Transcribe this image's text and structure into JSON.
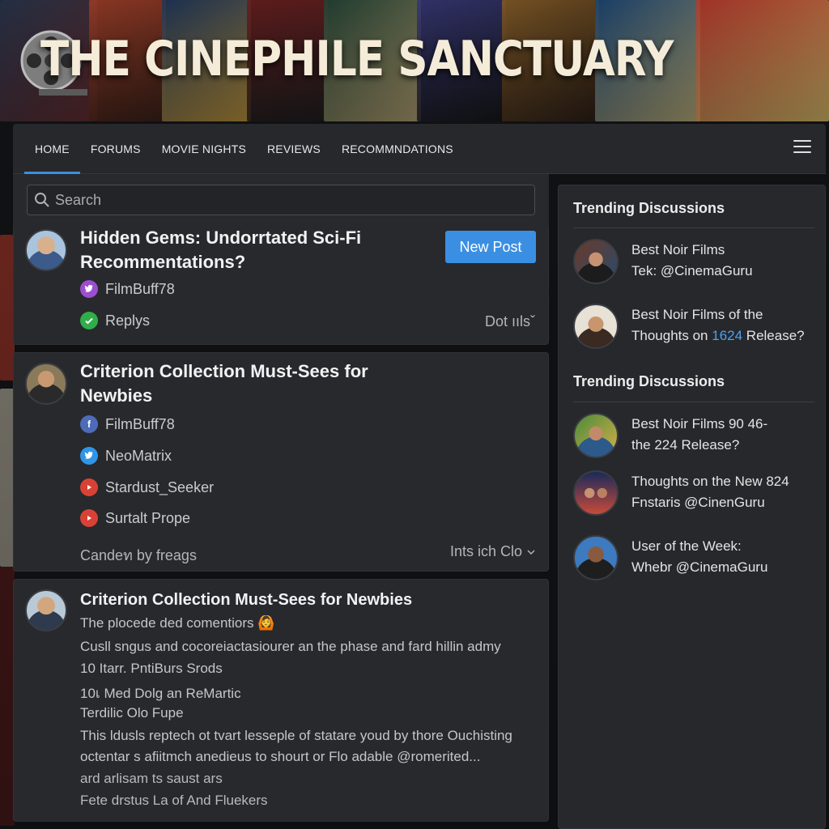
{
  "site": {
    "title": "THE CINEPHILE SANCTUARY"
  },
  "nav": {
    "tabs": [
      {
        "label": "HOME",
        "active": true
      },
      {
        "label": "FORUMS",
        "active": false
      },
      {
        "label": "MOVIE NIGHTS",
        "active": false
      },
      {
        "label": "REVIEWS",
        "active": false
      },
      {
        "label": "RECOMMNDATIONS",
        "active": false
      }
    ],
    "menu_icon": "hamburger-icon"
  },
  "search": {
    "placeholder": "Search"
  },
  "posts": [
    {
      "title_line1": "Hidden Gems: Undorrtated Sci-Fi",
      "title_line2": "Recommentations?",
      "user": {
        "name": "FilmBuff78",
        "icon": "twitter-icon",
        "color": "#9b4fd0"
      },
      "replies_label": "Replys",
      "replies_icon": "check-icon",
      "meta_right": "Dot ıılsˇ",
      "new_post_label": "New Post"
    },
    {
      "title_line1": "Criterion Collection Must-Sees for",
      "title_line2": "Newbies",
      "users": [
        {
          "name": "FilmBuff78",
          "icon": "facebook-icon",
          "color": "#4d6bb8"
        },
        {
          "name": "NeoMatrix",
          "icon": "twitter-icon",
          "color": "#2f95e8"
        },
        {
          "name": "Stardust_Seeker",
          "icon": "youtube-icon",
          "color": "#d84236"
        },
        {
          "name": "Surtalt Prope",
          "icon": "youtube-icon",
          "color": "#d84236"
        }
      ],
      "footer_left": "Candeท by freags",
      "footer_right": "Ints ich Clo"
    },
    {
      "title": "Criterion Collection Must-Sees for Newbies",
      "subtitle": "The plocede ded comentiors",
      "subtitle_emoji": "🙆",
      "lines": [
        "Cusll sngus and cocoreiactasiourer an the phase and fard hillin admy",
        "10 Itarr. PntiBurs Srods",
        "10เ Med Dolg an ReMartic",
        "Terdilic Olo Fupe",
        "This ldusls reptech ot tvart lesseple of statare youd by thore Ouchisting",
        "octentar s afiitmch anedieus to shourt or Flo adable @romerited...",
        "ard arlisam ts saust ars",
        "Fete drstus La of And Fluekers"
      ]
    }
  ],
  "sidebar": {
    "sections": [
      {
        "heading": "Trending Discussions",
        "items": [
          {
            "line1": "Best Noir Films",
            "line2": "Tek: @CinemaGuru"
          },
          {
            "line1": "Best Noir Films of the",
            "line2_prefix": "Thoughts on ",
            "line2_highlight": "1624",
            "line2_suffix": " Release?"
          }
        ]
      },
      {
        "heading": "Trending Discussions",
        "items": [
          {
            "line1": "Best Noir Films 90 46-",
            "line2": "the 224 Release?"
          },
          {
            "line1": "Thoughts on the New 824",
            "line2": "Fnstaris @CinenGuru"
          },
          {
            "line1": "User of the Week:",
            "line2": "Whebr @CinemaGuru"
          }
        ]
      }
    ]
  },
  "colors": {
    "accent": "#3b8fe3",
    "link": "#4ea1ef",
    "panel": "#27292d",
    "title": "#f4ecd8"
  }
}
